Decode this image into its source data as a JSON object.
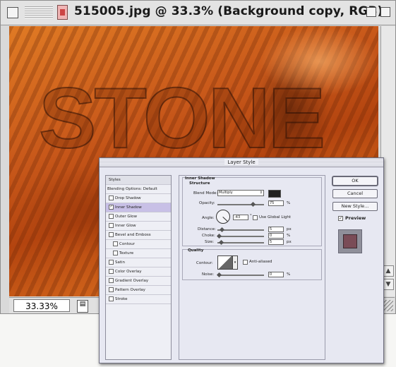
{
  "window": {
    "title": "515005.jpg @ 33.3% (Background copy, RGB)",
    "zoom": "33.33%",
    "canvas_text": "STONE"
  },
  "dialog": {
    "title": "Layer Style",
    "styles_list": {
      "header": "Styles",
      "blending": "Blending Options: Default",
      "items": [
        {
          "label": "Drop Shadow",
          "checked": false,
          "sub": false
        },
        {
          "label": "Inner Shadow",
          "checked": true,
          "sub": false,
          "selected": true
        },
        {
          "label": "Outer Glow",
          "checked": false,
          "sub": false
        },
        {
          "label": "Inner Glow",
          "checked": false,
          "sub": false
        },
        {
          "label": "Bevel and Emboss",
          "checked": false,
          "sub": false
        },
        {
          "label": "Contour",
          "checked": false,
          "sub": true
        },
        {
          "label": "Texture",
          "checked": false,
          "sub": true
        },
        {
          "label": "Satin",
          "checked": false,
          "sub": false
        },
        {
          "label": "Color Overlay",
          "checked": false,
          "sub": false
        },
        {
          "label": "Gradient Overlay",
          "checked": false,
          "sub": false
        },
        {
          "label": "Pattern Overlay",
          "checked": false,
          "sub": false
        },
        {
          "label": "Stroke",
          "checked": false,
          "sub": false
        }
      ]
    },
    "inner_shadow": {
      "title": "Inner Shadow",
      "structure": "Structure",
      "blend_mode_label": "Blend Mode:",
      "blend_mode": "Multiply",
      "opacity_label": "Opacity:",
      "opacity": "75",
      "angle_label": "Angle:",
      "angle": "-43",
      "global_light": "Use Global Light",
      "distance_label": "Distance:",
      "distance": "5",
      "choke_label": "Choke:",
      "choke": "0",
      "size_label": "Size:",
      "size": "5",
      "px": "px",
      "pct": "%",
      "deg": "°",
      "quality": "Quality",
      "contour_label": "Contour:",
      "anti_aliased": "Anti-aliased",
      "noise_label": "Noise:",
      "noise": "0"
    },
    "buttons": {
      "ok": "OK",
      "cancel": "Cancel",
      "new_style": "New Style...",
      "preview": "Preview"
    }
  }
}
